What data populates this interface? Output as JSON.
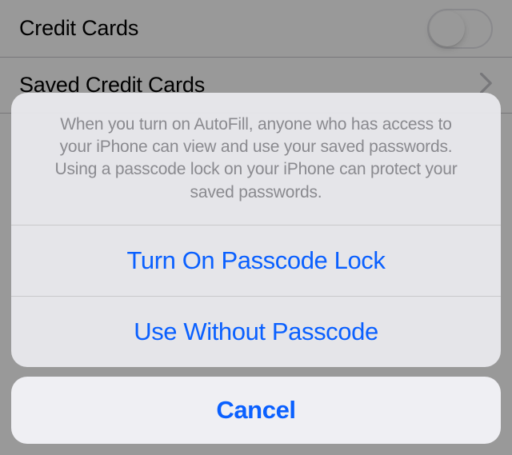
{
  "settings": {
    "credit_cards_label": "Credit Cards",
    "saved_credit_cards_label": "Saved Credit Cards"
  },
  "action_sheet": {
    "message": "When you turn on AutoFill, anyone who has access to your iPhone can view and use your saved passwords. Using a passcode lock on your iPhone can protect your saved passwords.",
    "option_passcode": "Turn On Passcode Lock",
    "option_without": "Use Without Passcode",
    "cancel": "Cancel"
  }
}
